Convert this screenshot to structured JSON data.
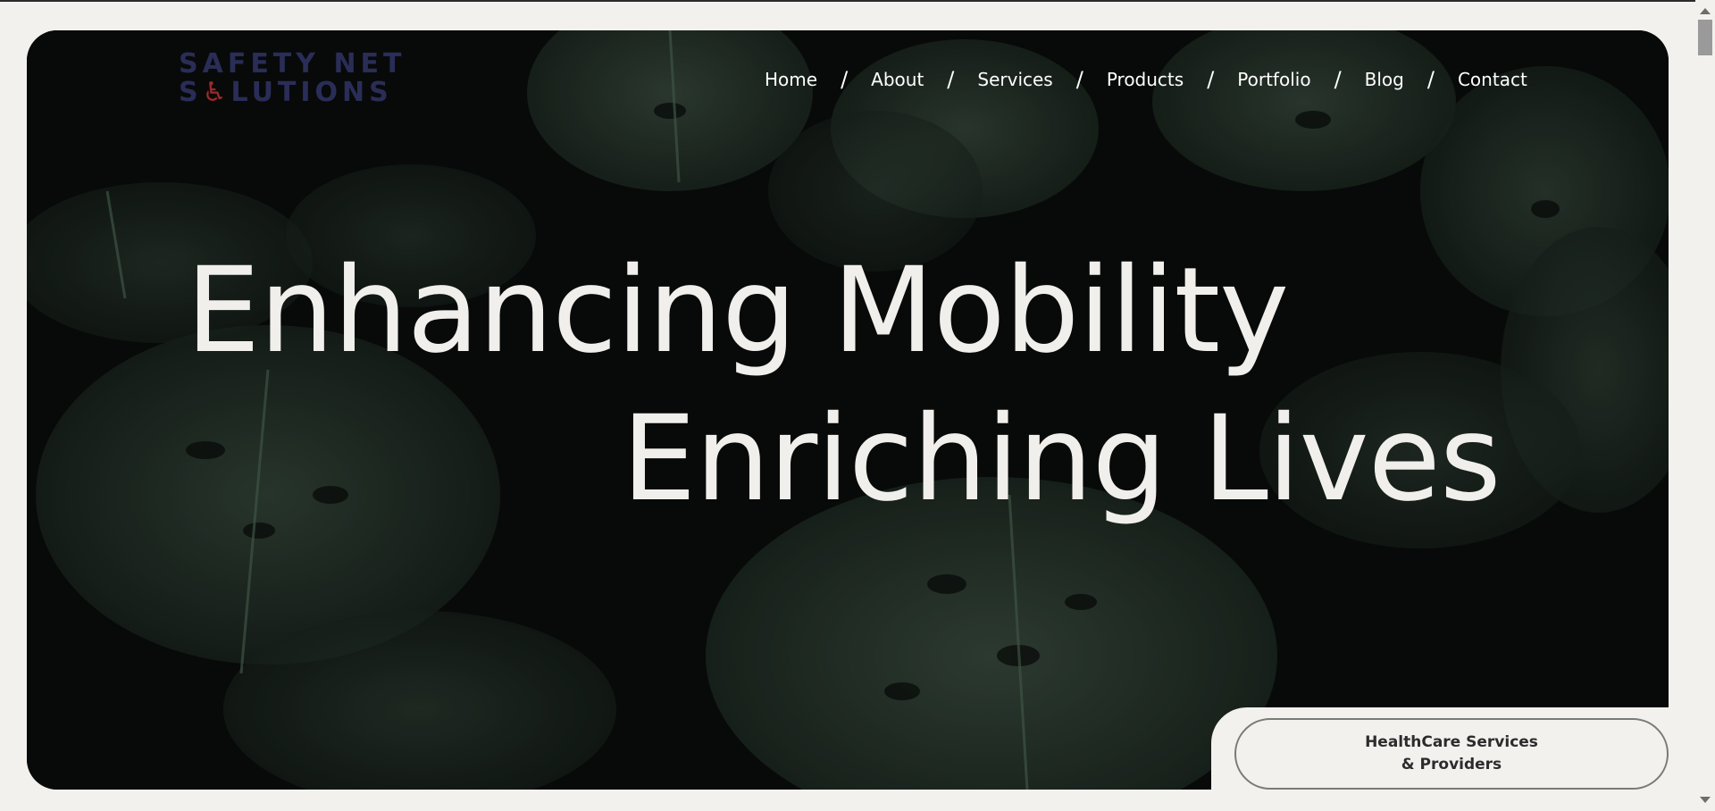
{
  "logo": {
    "line1": "SAFETY NET",
    "line2_pre": "S",
    "line2_wheel": "♿",
    "line2_post": "LUTIONS"
  },
  "nav": {
    "items": [
      "Home",
      "About",
      "Services",
      "Products",
      "Portfolio",
      "Blog",
      "Contact"
    ],
    "separator": "/"
  },
  "hero": {
    "headline_line1": "Enhancing Mobility",
    "headline_line2": "Enriching Lives"
  },
  "cta": {
    "line1": "HealthCare Services",
    "line2": "& Providers"
  },
  "colors": {
    "page_bg": "#f2f1ee",
    "hero_bg": "#0b0e0c",
    "leaf": "#2c3a31",
    "logo": "#2a2d57",
    "logo_accent": "#9b2a2a",
    "headline": "#f0efeb"
  }
}
